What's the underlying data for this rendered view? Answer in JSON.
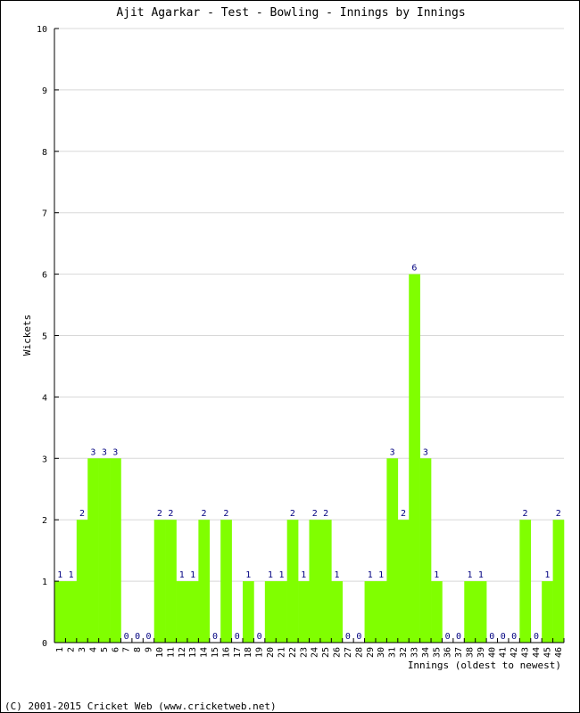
{
  "chart_data": {
    "type": "bar",
    "title": "Ajit Agarkar - Test - Bowling - Innings by Innings",
    "xlabel": "Innings (oldest to newest)",
    "ylabel": "Wickets",
    "ylim": [
      0,
      10
    ],
    "yticks": [
      0,
      1,
      2,
      3,
      4,
      5,
      6,
      7,
      8,
      9,
      10
    ],
    "grid": true,
    "categories": [
      "1",
      "2",
      "3",
      "4",
      "5",
      "6",
      "7",
      "8",
      "9",
      "10",
      "11",
      "12",
      "13",
      "14",
      "15",
      "16",
      "17",
      "18",
      "19",
      "20",
      "21",
      "22",
      "23",
      "24",
      "25",
      "26",
      "27",
      "28",
      "29",
      "30",
      "31",
      "32",
      "33",
      "34",
      "35",
      "36",
      "37",
      "38",
      "39",
      "40",
      "41",
      "42",
      "43",
      "44",
      "45",
      "46"
    ],
    "values": [
      1,
      1,
      2,
      3,
      3,
      3,
      0,
      0,
      0,
      2,
      2,
      1,
      1,
      2,
      0,
      2,
      0,
      1,
      0,
      1,
      1,
      2,
      1,
      2,
      2,
      1,
      0,
      0,
      1,
      1,
      3,
      2,
      6,
      3,
      1,
      0,
      0,
      1,
      1,
      0,
      0,
      0,
      2,
      0,
      1,
      2
    ],
    "bar_color": "#80ff00",
    "label_color": "#000080"
  },
  "footer": "(C) 2001-2015 Cricket Web (www.cricketweb.net)"
}
